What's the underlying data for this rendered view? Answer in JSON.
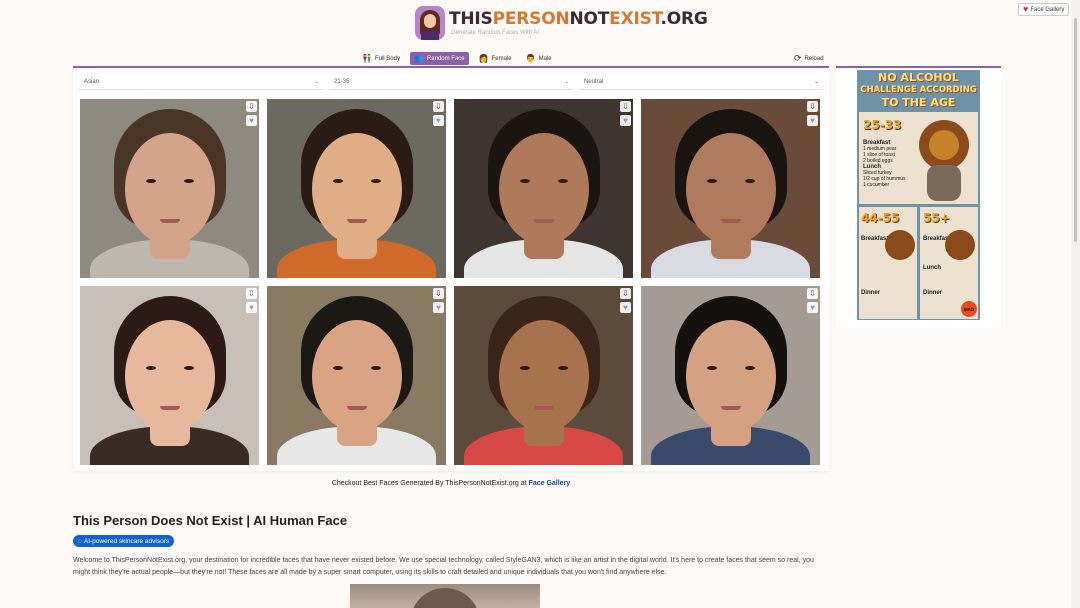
{
  "face_gallery_button": "Face Gallery",
  "logo": {
    "text_this": "THIS",
    "text_person": "PERSON",
    "text_not": "NOT",
    "text_exist": "EXIST",
    "text_org": ".ORG",
    "tagline": "Generate Random Faces With AI"
  },
  "tabs": [
    {
      "label": "Full Body",
      "icon": "full-body-icon",
      "active": false
    },
    {
      "label": "Random Face",
      "icon": "group-icon",
      "active": true
    },
    {
      "label": "Female",
      "icon": "female-icon",
      "active": false
    },
    {
      "label": "Male",
      "icon": "male-icon",
      "active": false
    }
  ],
  "reload_label": "Reload",
  "filters": {
    "ethnicity": "Asian",
    "age": "21-35",
    "emotion": "Neutral"
  },
  "faces": [
    {
      "hair": "#4a3424",
      "skin": "#d4a48a",
      "bg": "#8e8a80",
      "shirt": "#bfb8ae"
    },
    {
      "hair": "#2a1c14",
      "skin": "#e0ad86",
      "bg": "#6c6a60",
      "shirt": "#d06a2a"
    },
    {
      "hair": "#1c1410",
      "skin": "#b07a5a",
      "bg": "#3e3430",
      "shirt": "#e6e6e6"
    },
    {
      "hair": "#1a1410",
      "skin": "#b07a5e",
      "bg": "#6a4a38",
      "shirt": "#d8dce2"
    },
    {
      "hair": "#2c1a16",
      "skin": "#e8b89c",
      "bg": "#c8c0b8",
      "shirt": "#3a2a24"
    },
    {
      "hair": "#1c1814",
      "skin": "#d9a384",
      "bg": "#8a7a64",
      "shirt": "#e8e8e8"
    },
    {
      "hair": "#3a2418",
      "skin": "#a8724e",
      "bg": "#5c4a3a",
      "shirt": "#d84844"
    },
    {
      "hair": "#14100e",
      "skin": "#d4a282",
      "bg": "#a49c94",
      "shirt": "#3a4a6a"
    }
  ],
  "checkout": {
    "text": "Checkout Best Faces Generated By ThisPersonNotExist.org at",
    "link": "Face Gallery"
  },
  "ad": {
    "line1": "NO ALCOHOL",
    "line2": "CHALLENGE ACCORDING",
    "line3": "TO THE AGE",
    "age1": "25-33",
    "age2": "44-55",
    "age3": "55+",
    "breakfast": "Breakfast",
    "lunch": "Lunch",
    "dinner": "Dinner",
    "breakfast_items": "1 medium pear\n1 slice of toast\n2 boiled eggs",
    "lunch_items": "Sliced turkey\n1/2 cup of hummus\n1 cucumber",
    "brand": "MAD"
  },
  "article": {
    "heading": "This Person Does Not Exist | AI Human Face",
    "badge": "AI-powered skincare advisors",
    "paragraph": "Welcome to ThisPersonNotExist.org, your destination for incredible faces that have never existed before. We use special technology, called StyleGAN3, which is like an artist in the digital world. It's here to create faces that seem so real, you might think they're actual people—but they're not! These faces are all made by a super smart computer, using its skills to craft detailed and unique individuals that you won't find anywhere else."
  }
}
